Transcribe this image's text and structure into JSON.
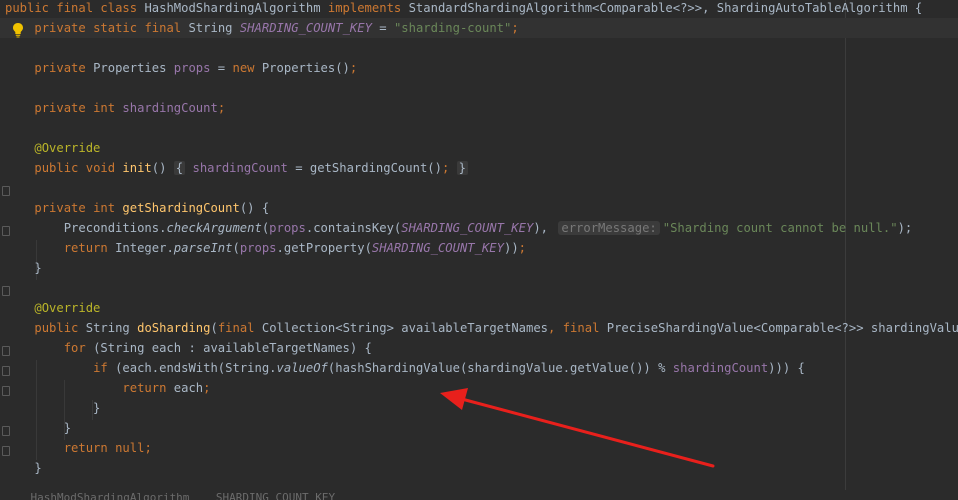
{
  "editor": {
    "lines": [
      {
        "segments": [
          {
            "t": "public ",
            "c": "kw"
          },
          {
            "t": "final ",
            "c": "kw"
          },
          {
            "t": "class ",
            "c": "kw"
          },
          {
            "t": "HashModShardingAlgorithm ",
            "c": "dim"
          },
          {
            "t": "implements ",
            "c": "kw"
          },
          {
            "t": "StandardShardingAlgorithm<Comparable<?>>, ShardingAutoTableAlgorithm {",
            "c": "dim"
          }
        ]
      },
      {
        "highlight": true,
        "segments": [
          {
            "t": "    "
          },
          {
            "t": "private ",
            "c": "kw"
          },
          {
            "t": "static ",
            "c": "kw"
          },
          {
            "t": "final ",
            "c": "kw"
          },
          {
            "t": "String "
          },
          {
            "t": "SHARDING_COUNT_KEY",
            "c": "cst"
          },
          {
            "t": " = "
          },
          {
            "t": "\"sharding-count\"",
            "c": "str"
          },
          {
            "t": ";",
            "c": "kw"
          }
        ]
      },
      {
        "segments": []
      },
      {
        "segments": [
          {
            "t": "    "
          },
          {
            "t": "private ",
            "c": "kw"
          },
          {
            "t": "Properties "
          },
          {
            "t": "props",
            "c": "fld"
          },
          {
            "t": " = "
          },
          {
            "t": "new ",
            "c": "kw"
          },
          {
            "t": "Properties()"
          },
          {
            "t": ";",
            "c": "kw"
          }
        ]
      },
      {
        "segments": []
      },
      {
        "segments": [
          {
            "t": "    "
          },
          {
            "t": "private ",
            "c": "kw"
          },
          {
            "t": "int ",
            "c": "kw"
          },
          {
            "t": "shardingCount",
            "c": "fld"
          },
          {
            "t": ";",
            "c": "kw"
          }
        ]
      },
      {
        "segments": []
      },
      {
        "segments": [
          {
            "t": "    "
          },
          {
            "t": "@Override",
            "c": "ann"
          }
        ]
      },
      {
        "segments": [
          {
            "t": "    "
          },
          {
            "t": "public ",
            "c": "kw"
          },
          {
            "t": "void ",
            "c": "kw"
          },
          {
            "t": "init",
            "c": "fn"
          },
          {
            "t": "() "
          },
          {
            "t": "{",
            "c": "fold"
          },
          {
            "t": " "
          },
          {
            "t": "shardingCount",
            "c": "fld"
          },
          {
            "t": " = getShardingCount()"
          },
          {
            "t": ";",
            "c": "kw"
          },
          {
            "t": " "
          },
          {
            "t": "}",
            "c": "fold"
          }
        ]
      },
      {
        "segments": []
      },
      {
        "segments": [
          {
            "t": "    "
          },
          {
            "t": "private ",
            "c": "kw"
          },
          {
            "t": "int ",
            "c": "kw"
          },
          {
            "t": "getShardingCount",
            "c": "fn"
          },
          {
            "t": "() {"
          }
        ]
      },
      {
        "segments": [
          {
            "t": "        Preconditions."
          },
          {
            "t": "checkArgument",
            "c": "it"
          },
          {
            "t": "("
          },
          {
            "t": "props",
            "c": "fld"
          },
          {
            "t": ".containsKey("
          },
          {
            "t": "SHARDING_COUNT_KEY",
            "c": "cst"
          },
          {
            "t": "),",
            "c": "dim"
          },
          {
            "t": " "
          },
          {
            "t": "errorMessage:",
            "c": "hint"
          },
          {
            "t": "\"Sharding count cannot be null.\"",
            "c": "str"
          },
          {
            "t": ");"
          }
        ]
      },
      {
        "segments": [
          {
            "t": "        "
          },
          {
            "t": "return ",
            "c": "kw"
          },
          {
            "t": "Integer."
          },
          {
            "t": "parseInt",
            "c": "it"
          },
          {
            "t": "("
          },
          {
            "t": "props",
            "c": "fld"
          },
          {
            "t": ".getProperty("
          },
          {
            "t": "SHARDING_COUNT_KEY",
            "c": "cst"
          },
          {
            "t": "))"
          },
          {
            "t": ";",
            "c": "kw"
          }
        ]
      },
      {
        "segments": [
          {
            "t": "    }"
          }
        ]
      },
      {
        "segments": []
      },
      {
        "segments": [
          {
            "t": "    "
          },
          {
            "t": "@Override",
            "c": "ann"
          }
        ]
      },
      {
        "segments": [
          {
            "t": "    "
          },
          {
            "t": "public ",
            "c": "kw"
          },
          {
            "t": "String "
          },
          {
            "t": "doSharding",
            "c": "fn"
          },
          {
            "t": "("
          },
          {
            "t": "final ",
            "c": "kw"
          },
          {
            "t": "Collection<String> availableTargetNames"
          },
          {
            "t": ", ",
            "c": "kw"
          },
          {
            "t": "final ",
            "c": "kw"
          },
          {
            "t": "PreciseShardingValue<Comparable<?>> shardingValue) {"
          }
        ]
      },
      {
        "segments": [
          {
            "t": "        "
          },
          {
            "t": "for ",
            "c": "kw"
          },
          {
            "t": "(String each : availableTargetNames) {"
          }
        ]
      },
      {
        "segments": [
          {
            "t": "            "
          },
          {
            "t": "if ",
            "c": "kw"
          },
          {
            "t": "(each.endsWith(String."
          },
          {
            "t": "valueOf",
            "c": "it"
          },
          {
            "t": "(hashShardingValue(shardingValue.getValue()) % "
          },
          {
            "t": "shardingCount",
            "c": "fld"
          },
          {
            "t": "))) {"
          }
        ]
      },
      {
        "segments": [
          {
            "t": "                "
          },
          {
            "t": "return ",
            "c": "kw"
          },
          {
            "t": "each"
          },
          {
            "t": ";",
            "c": "kw"
          }
        ]
      },
      {
        "segments": [
          {
            "t": "            }"
          }
        ]
      },
      {
        "segments": [
          {
            "t": "        }"
          }
        ]
      },
      {
        "segments": [
          {
            "t": "        "
          },
          {
            "t": "return ",
            "c": "kw"
          },
          {
            "t": "null",
            "c": "kw"
          },
          {
            "t": ";",
            "c": "kw"
          }
        ]
      },
      {
        "segments": [
          {
            "t": "    }"
          }
        ]
      }
    ],
    "bottom_partial_text": "    HashModShardingAlgorithm    SHARDING_COUNT_KEY"
  },
  "icons": {
    "intention_bulb": "lightbulb-icon",
    "annotation_arrow": "red-arrow-annotation"
  },
  "colors": {
    "background": "#2b2b2b",
    "keyword": "#cc7832",
    "string": "#6a8759",
    "field": "#9876aa",
    "method": "#ffc66d",
    "annotation": "#bbb529",
    "arrow": "#e8201c",
    "bulb": "#f0c200"
  }
}
